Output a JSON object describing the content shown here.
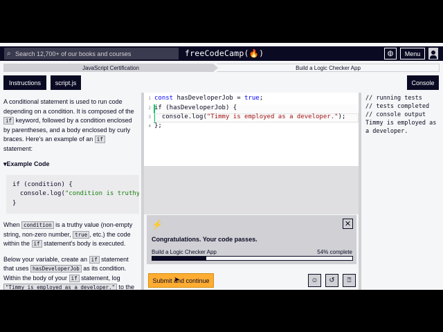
{
  "navbar": {
    "search_placeholder": "Search 12,700+ of our books and courses",
    "logo": "freeCodeCamp(🔥)",
    "menu_label": "Menu"
  },
  "breadcrumb": {
    "certification": "JavaScript Certification",
    "project": "Build a Logic Checker App"
  },
  "tabs": {
    "instructions": "Instructions",
    "script": "script.js",
    "console": "Console"
  },
  "instructions": {
    "p1_a": "A conditional statement is used to run code depending on a condition. It is composed of the ",
    "p1_code1": "if",
    "p1_b": " keyword, followed by a condition enclosed by parentheses, and a body enclosed by curly braces. Here's an example of an ",
    "p1_code2": "if",
    "p1_c": " statement:",
    "example_heading": "Example Code",
    "example_line1": "if (condition) {",
    "example_line2_a": "  console.log(",
    "example_line2_str": "\"condition is truthy\"",
    "example_line3": "}",
    "p2_a": "When ",
    "p2_code1": "condition",
    "p2_b": " is a truthy value (non-empty string, non-zero number, ",
    "p2_code2": "true",
    "p2_c": ", etc.) the code within the ",
    "p2_code3": "if",
    "p2_d": " statement's body is executed.",
    "p3_a": "Below your variable, create an ",
    "p3_code1": "if",
    "p3_b": " statement that uses ",
    "p3_code2": "hasDeveloperJob",
    "p3_c": " as its condition. Within the body of your ",
    "p3_code3": "if",
    "p3_d": " statement, log ",
    "p3_code4": "\"Timmy is employed as a developer.\"",
    "p3_e": " to the console."
  },
  "editor": {
    "lines": [
      {
        "num": "1",
        "kw": "const",
        "rest": " hasDeveloperJob = ",
        "kw2": "true",
        "end": ";"
      },
      {
        "num": "2",
        "text": "if (hasDeveloperJob) {"
      },
      {
        "num": "3",
        "pre": "  console.log(",
        "str": "\"Timmy is employed as a developer.\"",
        "post": ");"
      },
      {
        "num": "4",
        "text": "};"
      }
    ]
  },
  "success": {
    "message": "Congratulations. Your code passes.",
    "course": "Build a Logic Checker App",
    "percent_label": "54% complete",
    "progress": 0.54
  },
  "actions": {
    "submit_label": "Submit and continue"
  },
  "console": {
    "lines": [
      "// running tests",
      "// tests completed",
      "// console output",
      "Timmy is employed as a developer."
    ]
  }
}
